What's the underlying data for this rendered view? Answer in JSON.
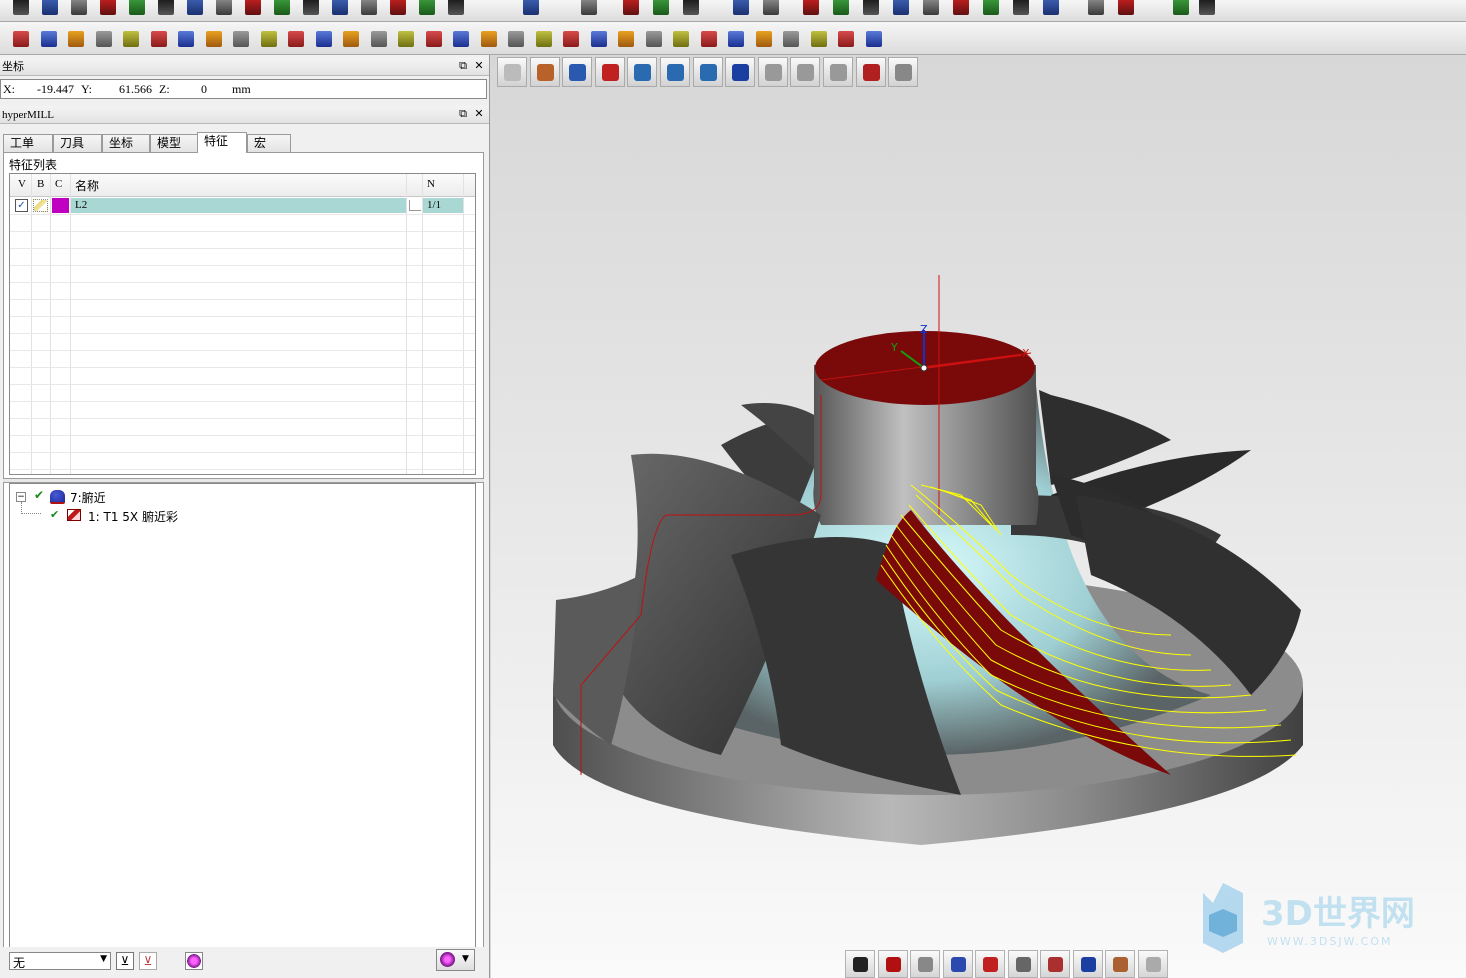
{
  "coordinate_panel": {
    "title": "坐标",
    "x_label": "X:",
    "x_value": "-19.447",
    "y_label": "Y:",
    "y_value": "61.566",
    "z_label": "Z:",
    "z_value": "0",
    "unit": "mm"
  },
  "hypermill_panel": {
    "title": "hyperMILL",
    "tabs": [
      "工单",
      "刀具",
      "坐标",
      "模型",
      "特征",
      "宏"
    ],
    "active_tab": "特征",
    "feature_list_title": "特征列表",
    "columns": [
      "V",
      "B",
      "C",
      "名称",
      "N"
    ],
    "rows": [
      {
        "checked": true,
        "color": "#c000c0",
        "name": "L2",
        "n": "1/1"
      }
    ]
  },
  "job_tree": {
    "items": [
      {
        "label": "7:腑近",
        "level": 0
      },
      {
        "label": "1: T1 5X 腑近彩",
        "level": 1
      }
    ]
  },
  "bottom": {
    "select_value": "无"
  },
  "viewport": {
    "axis_labels": {
      "x": "X",
      "y": "Y",
      "z": "Z"
    },
    "watermark": {
      "title": "3D世界网",
      "url": "WWW.3DSJW.COM"
    }
  },
  "colors": {
    "selected_row": "#a9d8d4",
    "part_gray": "#707070",
    "toolpath": "#ffff00",
    "stock_red": "#7a0a0a"
  }
}
